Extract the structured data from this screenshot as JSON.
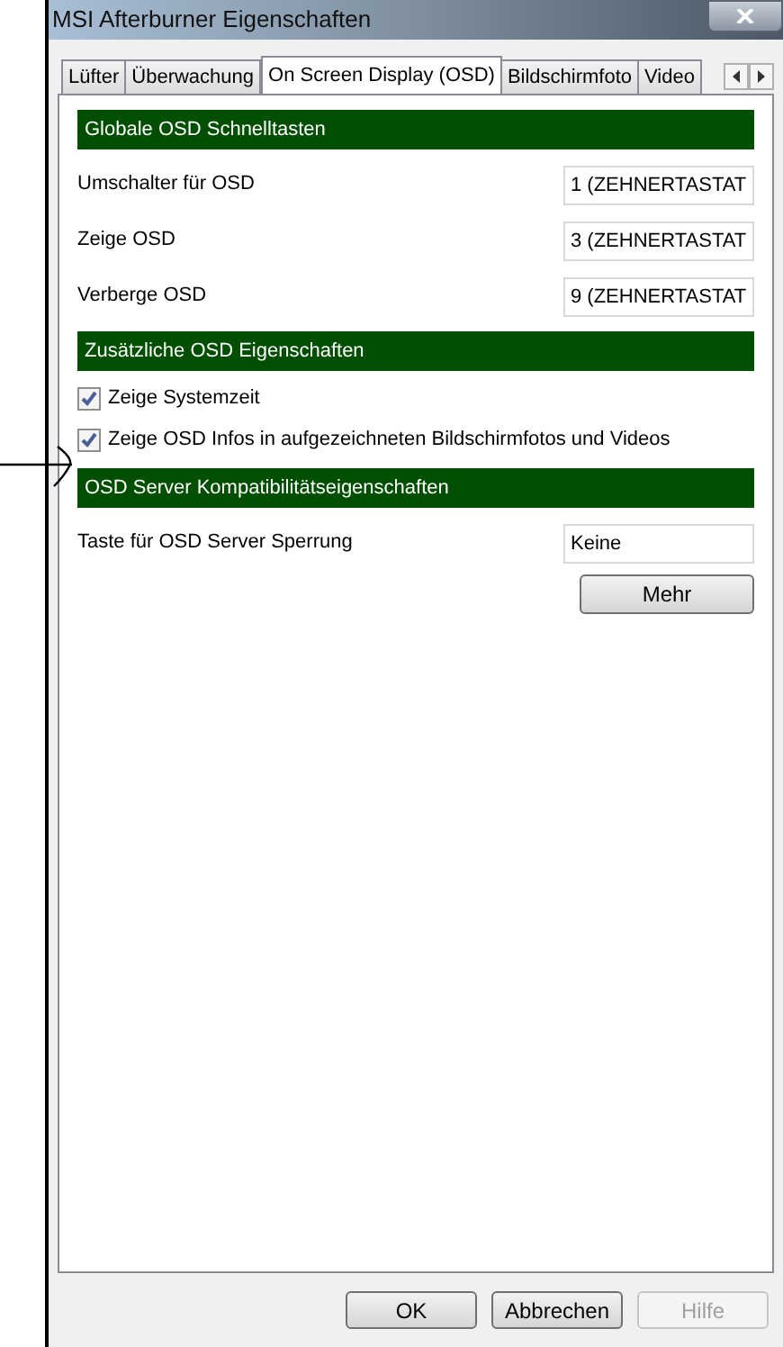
{
  "window": {
    "title": "MSI Afterburner Eigenschaften"
  },
  "tabs": [
    {
      "label": "Lüfter",
      "selected": false
    },
    {
      "label": "Überwachung",
      "selected": false
    },
    {
      "label": "On Screen Display (OSD)",
      "selected": true
    },
    {
      "label": "Bildschirmfoto",
      "selected": false
    },
    {
      "label": "Video",
      "selected": false
    }
  ],
  "sections": [
    {
      "title": "Globale OSD Schnelltasten",
      "items": [
        {
          "kind": "field",
          "label": "Umschalter für OSD",
          "value": "1 (ZEHNERTASTAT"
        },
        {
          "kind": "field",
          "label": "Zeige OSD",
          "value": "3 (ZEHNERTASTAT"
        },
        {
          "kind": "field",
          "label": "Verberge OSD",
          "value": "9 (ZEHNERTASTAT"
        }
      ]
    },
    {
      "title": "Zusätzliche OSD Eigenschaften",
      "items": [
        {
          "kind": "checkbox",
          "label": "Zeige Systemzeit",
          "checked": true
        },
        {
          "kind": "checkbox",
          "label": "Zeige OSD Infos in aufgezeichneten Bildschirmfotos und Videos",
          "checked": true
        }
      ]
    },
    {
      "title": "OSD Server Kompatibilitätseigenschaften",
      "items": [
        {
          "kind": "field",
          "label": "Taste für OSD Server Sperrung",
          "value": "Keine"
        },
        {
          "kind": "button",
          "label": "Mehr"
        }
      ]
    }
  ],
  "buttons": [
    {
      "label": "OK",
      "disabled": false
    },
    {
      "label": "Abbrechen",
      "disabled": false
    },
    {
      "label": "Hilfe",
      "disabled": true
    }
  ]
}
